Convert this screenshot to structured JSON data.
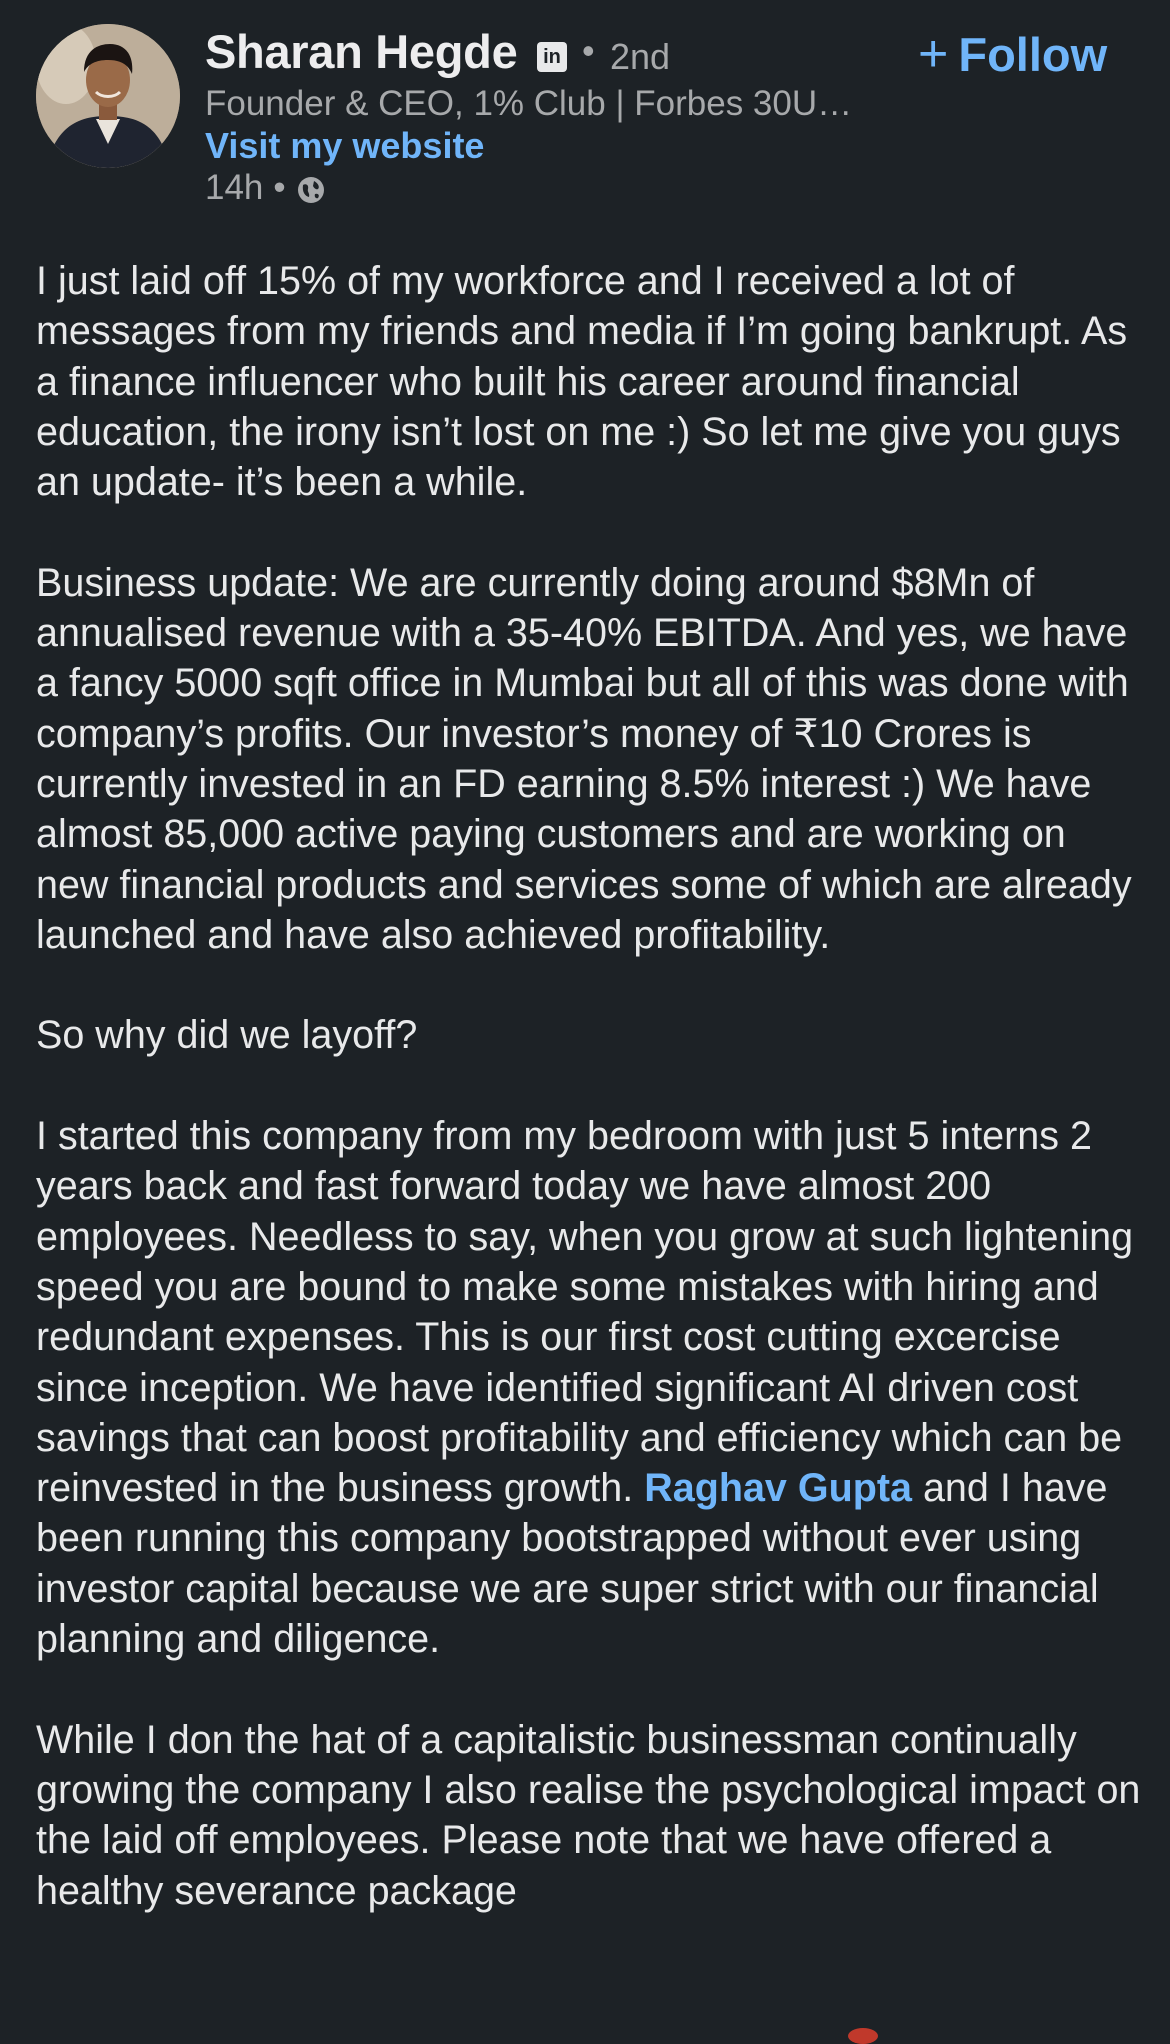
{
  "author": {
    "name": "Sharan Hegde",
    "badge": "in",
    "degree": "2nd",
    "separator": "•",
    "headline": "Founder & CEO, 1% Club | Forbes 30U…",
    "website_link": "Visit my website",
    "posted_time": "14h",
    "visibility_icon": "globe-icon"
  },
  "follow_button": {
    "plus": "+",
    "label": "Follow"
  },
  "post": {
    "p1": "I just laid off 15% of my workforce and I received a lot of messages from my friends and media if I’m going bankrupt. As a finance influencer who built his career around financial education, the irony isn’t lost on me :) So let me give you guys an update- it’s been a while.",
    "p2": "Business update: We are currently doing around $8Mn of annualised revenue with a 35-40% EBITDA. And yes, we have a fancy 5000 sqft office in Mumbai but all of this was done with company’s profits. Our investor’s money of ₹10 Crores is currently invested in an FD earning 8.5% interest :) We have almost 85,000 active paying customers and are working on new financial products and services some of which are already launched and have also achieved profitability.",
    "p3": "So why did we layoff?",
    "p4_before": "I started this company from my bedroom with just 5 interns 2 years back and fast forward today we have almost 200 employees. Needless to say, when you grow at such lightening speed you are bound to make some mistakes with hiring and redundant expenses. This is our first cost cutting excercise since inception. We have identified significant AI driven cost savings that can boost profitability and efficiency which can be reinvested in the business growth. ",
    "p4_mention": "Raghav Gupta",
    "p4_after": " and I have been running this company bootstrapped without ever using investor capital because we are super strict with our financial planning and diligence.",
    "p5": "While I don the hat of a capitalistic businessman continually growing the company I also realise the psychological impact on the laid off employees. Please note that we have offered a healthy severance package"
  },
  "colors": {
    "background": "#1d2226",
    "text": "#e8e9ea",
    "muted": "#a7a9ab",
    "link": "#70b5f9"
  }
}
